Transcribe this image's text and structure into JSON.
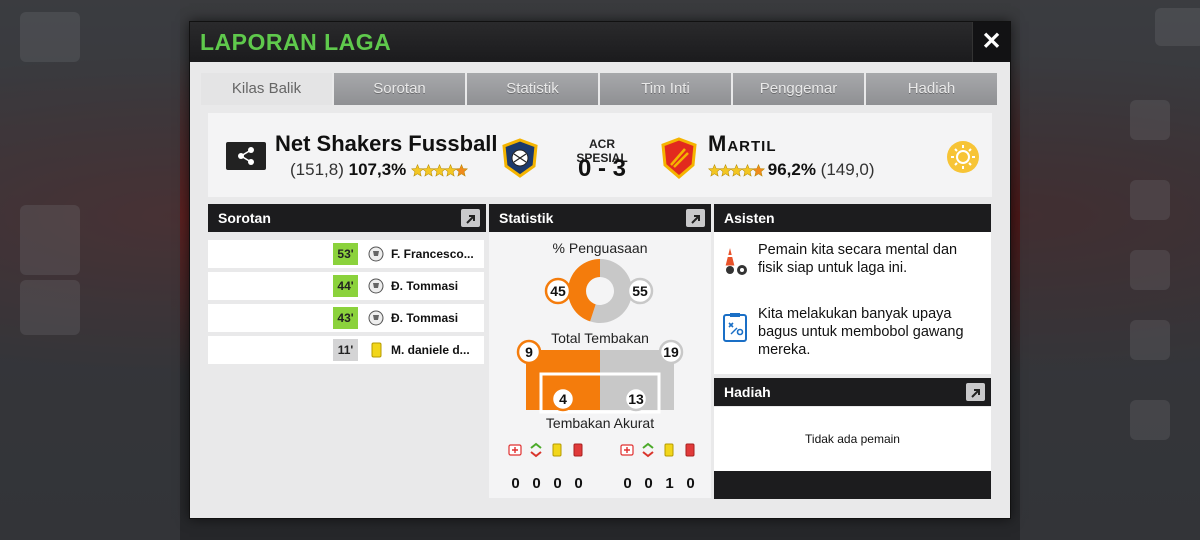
{
  "dialog": {
    "title": "LAPORAN LAGA",
    "close_label": "✕"
  },
  "tabs": [
    {
      "label": "Kilas Balik",
      "active": true
    },
    {
      "label": "Sorotan",
      "active": false
    },
    {
      "label": "Statistik",
      "active": false
    },
    {
      "label": "Tim Inti",
      "active": false
    },
    {
      "label": "Penggemar",
      "active": false
    },
    {
      "label": "Hadiah",
      "active": false
    }
  ],
  "match": {
    "home": {
      "name": "Net Shakers Fussball",
      "rating": "(151,8)",
      "percent": "107,3%",
      "stars": 4.5
    },
    "competition": "ACR SPESIAL",
    "score": "0 - 3",
    "away": {
      "name": "Martil",
      "rating": "(149,0)",
      "percent": "96,2%",
      "stars": 4.5
    },
    "weather": "sun-icon"
  },
  "highlights": {
    "title": "Sorotan",
    "events": [
      {
        "minute": "53'",
        "type": "goal",
        "player": "F. Francesco..."
      },
      {
        "minute": "44'",
        "type": "goal",
        "player": "Đ. Tommasi"
      },
      {
        "minute": "43'",
        "type": "goal",
        "player": "Đ. Tommasi"
      },
      {
        "minute": "11'",
        "type": "yellow-card",
        "player": "M. daniele d..."
      }
    ]
  },
  "stats": {
    "title": "Statistik",
    "possession_label": "% Penguasaan",
    "possession_home": "45",
    "possession_away": "55",
    "shots_label": "Total Tembakan",
    "shots_home": "9",
    "shots_away": "19",
    "on_target_label": "Tembakan Akurat",
    "on_target_home": "4",
    "on_target_away": "13",
    "home_counts": [
      "0",
      "0",
      "0",
      "0"
    ],
    "away_counts": [
      "0",
      "0",
      "1",
      "0"
    ],
    "count_icons": [
      "injury-icon",
      "substitution-icon",
      "yellow-card-icon",
      "red-card-icon"
    ],
    "home_color": "#f47c0c",
    "away_color": "#c8c8c8"
  },
  "assistant": {
    "title": "Asisten",
    "tips": [
      {
        "icon": "cones-icon",
        "text": "Pemain kita secara mental dan fisik siap untuk laga ini."
      },
      {
        "icon": "tactics-board-icon",
        "text": "Kita melakukan banyak upaya bagus untuk membobol gawang mereka."
      }
    ]
  },
  "rewards": {
    "title": "Hadiah",
    "empty_text": "Tidak ada pemain"
  }
}
